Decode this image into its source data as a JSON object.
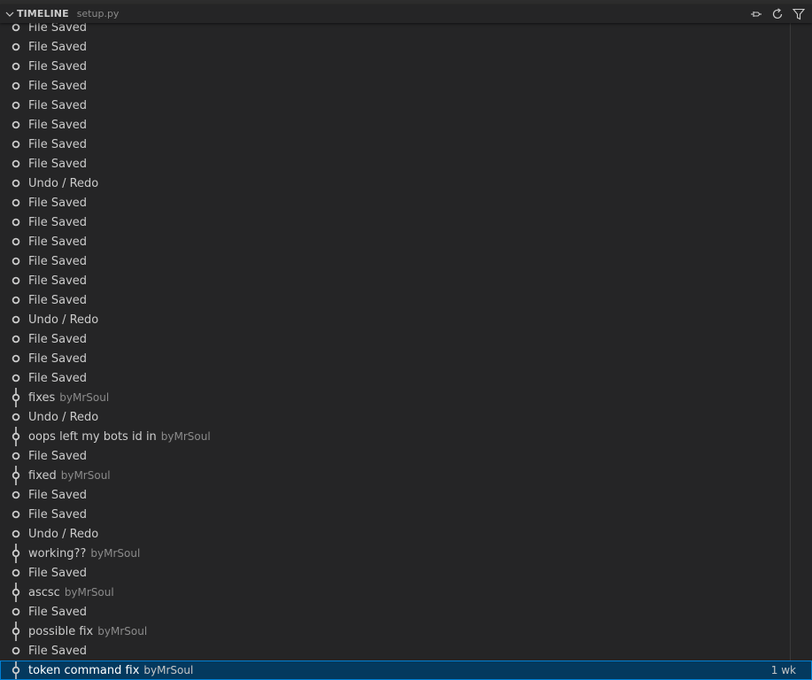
{
  "header": {
    "title": "TIMELINE",
    "description": "setup.py"
  },
  "items": [
    {
      "label": "File Saved",
      "kind": "local"
    },
    {
      "label": "File Saved",
      "kind": "local"
    },
    {
      "label": "File Saved",
      "kind": "local"
    },
    {
      "label": "File Saved",
      "kind": "local"
    },
    {
      "label": "File Saved",
      "kind": "local"
    },
    {
      "label": "File Saved",
      "kind": "local"
    },
    {
      "label": "File Saved",
      "kind": "local"
    },
    {
      "label": "File Saved",
      "kind": "local"
    },
    {
      "label": "Undo / Redo",
      "kind": "local"
    },
    {
      "label": "File Saved",
      "kind": "local"
    },
    {
      "label": "File Saved",
      "kind": "local"
    },
    {
      "label": "File Saved",
      "kind": "local"
    },
    {
      "label": "File Saved",
      "kind": "local"
    },
    {
      "label": "File Saved",
      "kind": "local"
    },
    {
      "label": "File Saved",
      "kind": "local"
    },
    {
      "label": "Undo / Redo",
      "kind": "local"
    },
    {
      "label": "File Saved",
      "kind": "local"
    },
    {
      "label": "File Saved",
      "kind": "local"
    },
    {
      "label": "File Saved",
      "kind": "local"
    },
    {
      "label": "fixes",
      "author": "byMrSoul",
      "kind": "commit"
    },
    {
      "label": "Undo / Redo",
      "kind": "local"
    },
    {
      "label": "oops left my bots id in",
      "author": "byMrSoul",
      "kind": "commit"
    },
    {
      "label": "File Saved",
      "kind": "local"
    },
    {
      "label": "fixed",
      "author": "byMrSoul",
      "kind": "commit"
    },
    {
      "label": "File Saved",
      "kind": "local"
    },
    {
      "label": "File Saved",
      "kind": "local"
    },
    {
      "label": "Undo / Redo",
      "kind": "local"
    },
    {
      "label": "working??",
      "author": "byMrSoul",
      "kind": "commit"
    },
    {
      "label": "File Saved",
      "kind": "local"
    },
    {
      "label": "ascsc",
      "author": "byMrSoul",
      "kind": "commit"
    },
    {
      "label": "File Saved",
      "kind": "local"
    },
    {
      "label": "possible fix",
      "author": "byMrSoul",
      "kind": "commit"
    },
    {
      "label": "File Saved",
      "kind": "local"
    },
    {
      "label": "token command fix",
      "author": "byMrSoul",
      "time": "1 wk",
      "kind": "commit",
      "selected": true
    }
  ],
  "icons": {
    "chevron": "chevron-down-icon",
    "pin": "pin-icon",
    "refresh": "refresh-icon",
    "filter": "filter-icon",
    "local": "circle-icon",
    "commit": "git-commit-icon"
  },
  "colors": {
    "background": "#252526",
    "selection": "#04395e",
    "selection_border": "#007fd4",
    "foreground": "#cccccc",
    "description": "#8b8b8b"
  }
}
